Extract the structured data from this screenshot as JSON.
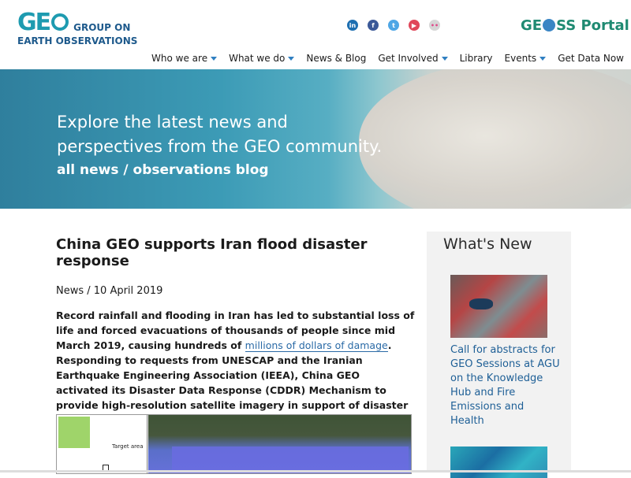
{
  "header": {
    "logo_mark": "GE",
    "logo_line1": "GROUP ON",
    "logo_line2": "EARTH OBSERVATIONS",
    "portal_prefix": "GE",
    "portal_suffix": "SS Portal",
    "social": [
      {
        "name": "linkedin-icon",
        "glyph": "in"
      },
      {
        "name": "facebook-icon",
        "glyph": "f"
      },
      {
        "name": "twitter-icon",
        "glyph": "t"
      },
      {
        "name": "youtube-icon",
        "glyph": "▶"
      },
      {
        "name": "flickr-icon",
        "glyph": "••"
      }
    ]
  },
  "nav": {
    "items": [
      {
        "label": "Who we are",
        "dropdown": true
      },
      {
        "label": "What we do",
        "dropdown": true
      },
      {
        "label": "News & Blog",
        "dropdown": false
      },
      {
        "label": "Get Involved",
        "dropdown": true
      },
      {
        "label": "Library",
        "dropdown": false
      },
      {
        "label": "Events",
        "dropdown": true
      },
      {
        "label": "Get Data Now",
        "dropdown": false
      }
    ]
  },
  "hero": {
    "title_line1": "Explore the latest news and",
    "title_line2": "perspectives from the GEO community.",
    "subtitle": "all news / observations blog"
  },
  "article": {
    "title": "China GEO supports Iran flood disaster response",
    "meta": "News / 10 April 2019",
    "body_before": "Record rainfall and flooding in Iran has led to substantial loss of life and forced evacuations of thousands of people since mid March 2019, causing hundreds of ",
    "body_link": "millions of dollars of damage",
    "body_after": ". Responding to requests from UNESCAP and the Iranian Earthquake Engineering Association (IEEA), China GEO activated its Disaster Data Response (CDDR) Mechanism to provide high-resolution satellite imagery in support of disaster response planning.",
    "figure_label": "Target area"
  },
  "sidebar": {
    "title": "What's New",
    "item1_link": "Call for abstracts for GEO Sessions at AGU on the Knowledge Hub and Fire Emissions and Health"
  },
  "colors": {
    "brand_teal": "#1e9bb0",
    "brand_navy": "#1e5a8c",
    "link_blue": "#2a6aa6",
    "portal_green": "#1f8a72"
  }
}
